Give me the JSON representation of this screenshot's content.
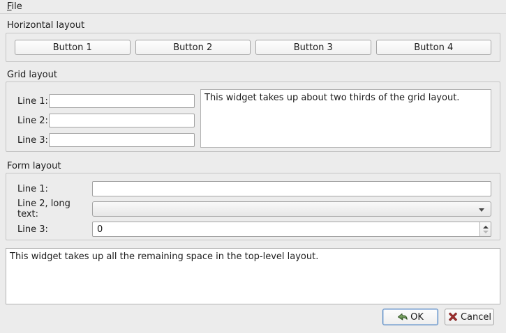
{
  "menu": {
    "file": {
      "mnemonic": "F",
      "rest": "ile"
    }
  },
  "groups": {
    "horizontal": {
      "title": "Horizontal layout",
      "buttons": [
        "Button 1",
        "Button 2",
        "Button 3",
        "Button 4"
      ]
    },
    "grid": {
      "title": "Grid layout",
      "rows": [
        {
          "label": "Line 1:",
          "value": ""
        },
        {
          "label": "Line 2:",
          "value": ""
        },
        {
          "label": "Line 3:",
          "value": ""
        }
      ],
      "textedit": "This widget takes up about two thirds of the grid layout."
    },
    "form": {
      "title": "Form layout",
      "rows": [
        {
          "label": "Line 1:",
          "type": "lineedit",
          "value": ""
        },
        {
          "label": "Line 2, long text:",
          "type": "combobox",
          "value": ""
        },
        {
          "label": "Line 3:",
          "type": "spinbox",
          "value": "0"
        }
      ]
    }
  },
  "bottom_textedit": "This widget takes up all the remaining space in the top-level layout.",
  "dialog_buttons": {
    "ok": "OK",
    "cancel": "Cancel"
  },
  "icons": {
    "ok": "green-enter-arrow-icon",
    "cancel": "red-x-icon",
    "combo": "chevron-down-icon",
    "spin_up": "spin-up-icon",
    "spin_down": "spin-down-icon"
  },
  "colors": {
    "window_bg": "#ececec",
    "ok_focus_border": "#4a80c0",
    "ok_icon_green": "#4a7a38",
    "cancel_icon_red": "#a03030"
  }
}
